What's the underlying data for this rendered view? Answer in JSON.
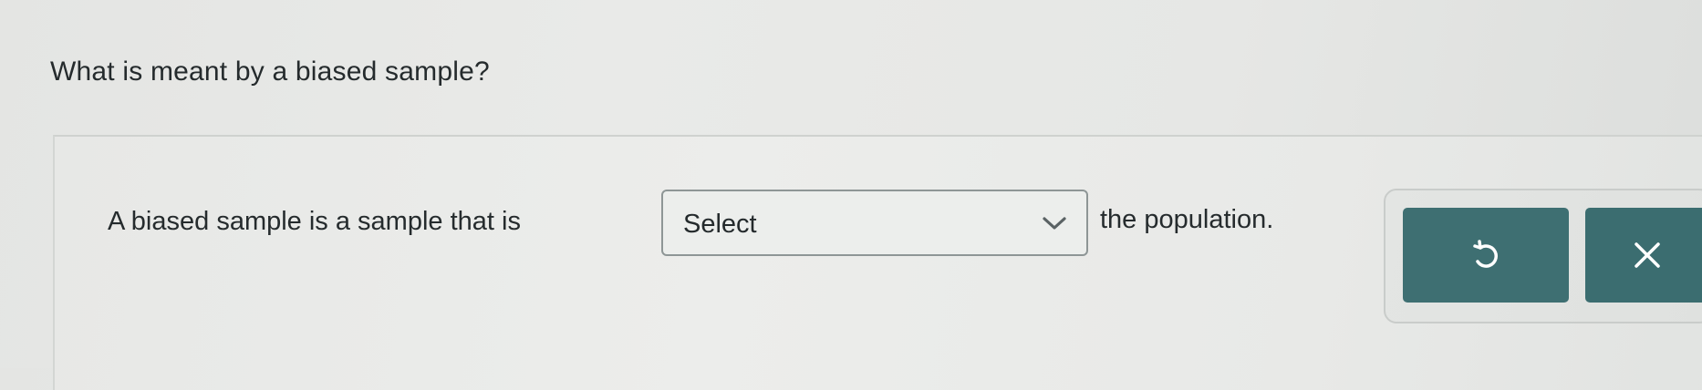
{
  "question": {
    "text": "What is meant by a biased sample?"
  },
  "answer": {
    "prefix": "A biased sample is a sample that is",
    "select": {
      "value": "Select",
      "icon": "chevron-down-icon"
    },
    "suffix": "the population."
  },
  "tools": {
    "undo_icon": "undo-icon",
    "clear_icon": "clear-x-icon",
    "button_color": "#3e6f72",
    "icon_color": "#ffffff"
  }
}
